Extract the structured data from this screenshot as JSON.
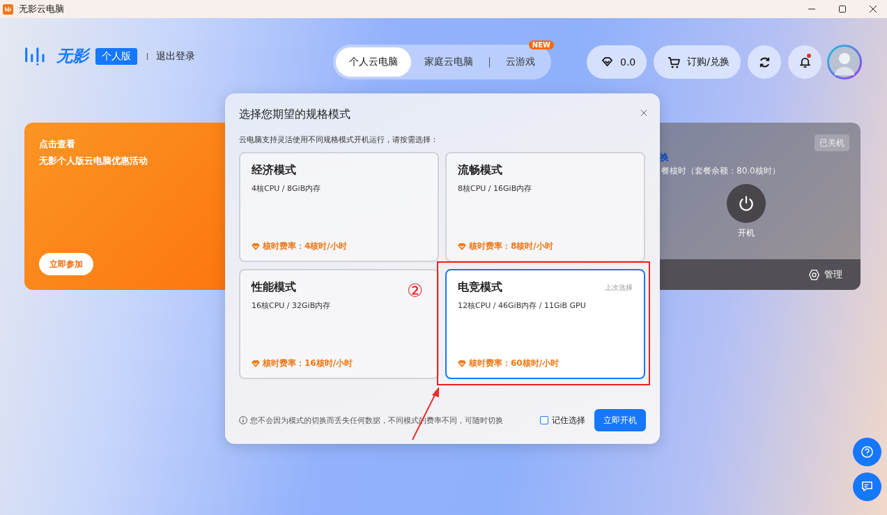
{
  "window": {
    "title": "无影云电脑"
  },
  "header": {
    "logo_text": "无影",
    "edition": "个人版",
    "logout": "退出登录",
    "tabs": [
      {
        "label": "个人云电脑",
        "selected": true
      },
      {
        "label": "家庭云电脑",
        "selected": false
      },
      {
        "label": "云游戏",
        "selected": false,
        "badge": "NEW"
      }
    ],
    "balance": "0.0",
    "shop": "订购/兑换",
    "has_unread": true
  },
  "promo_card": {
    "title": "点击查看",
    "subtitle": "无影个人版云电脑优惠活动",
    "button": "立即参加"
  },
  "computer_card": {
    "status": "已关机",
    "link_fragment": "换",
    "info_fragment": "餐核时（套餐余额：80.0核时）",
    "power_label": "开机",
    "manage": "管理"
  },
  "dialog": {
    "title": "选择您期望的规格模式",
    "subtitle": "云电脑支持灵活使用不同规格模式开机运行，请按需选择：",
    "modes": [
      {
        "name": "经济模式",
        "spec": "4核CPU / 8GiB内存",
        "rate": "核时费率：4核时/小时",
        "selected": false
      },
      {
        "name": "流畅模式",
        "spec": "8核CPU / 16GiB内存",
        "rate": "核时费率：8核时/小时",
        "selected": false
      },
      {
        "name": "性能模式",
        "spec": "16核CPU / 32GiB内存",
        "rate": "核时费率：16核时/小时",
        "selected": false
      },
      {
        "name": "电竞模式",
        "spec": "12核CPU / 46GiB内存 / 11GiB GPU",
        "rate": "核时费率：60核时/小时",
        "selected": true,
        "note": "上次选择"
      }
    ],
    "footer_note": "您不会因为模式的切换而丢失任何数据，不同模式的费率不同，可随时切换",
    "remember": {
      "label": "记住选择",
      "checked": false
    },
    "confirm": "立即开机"
  },
  "annotation": {
    "step": "②"
  }
}
